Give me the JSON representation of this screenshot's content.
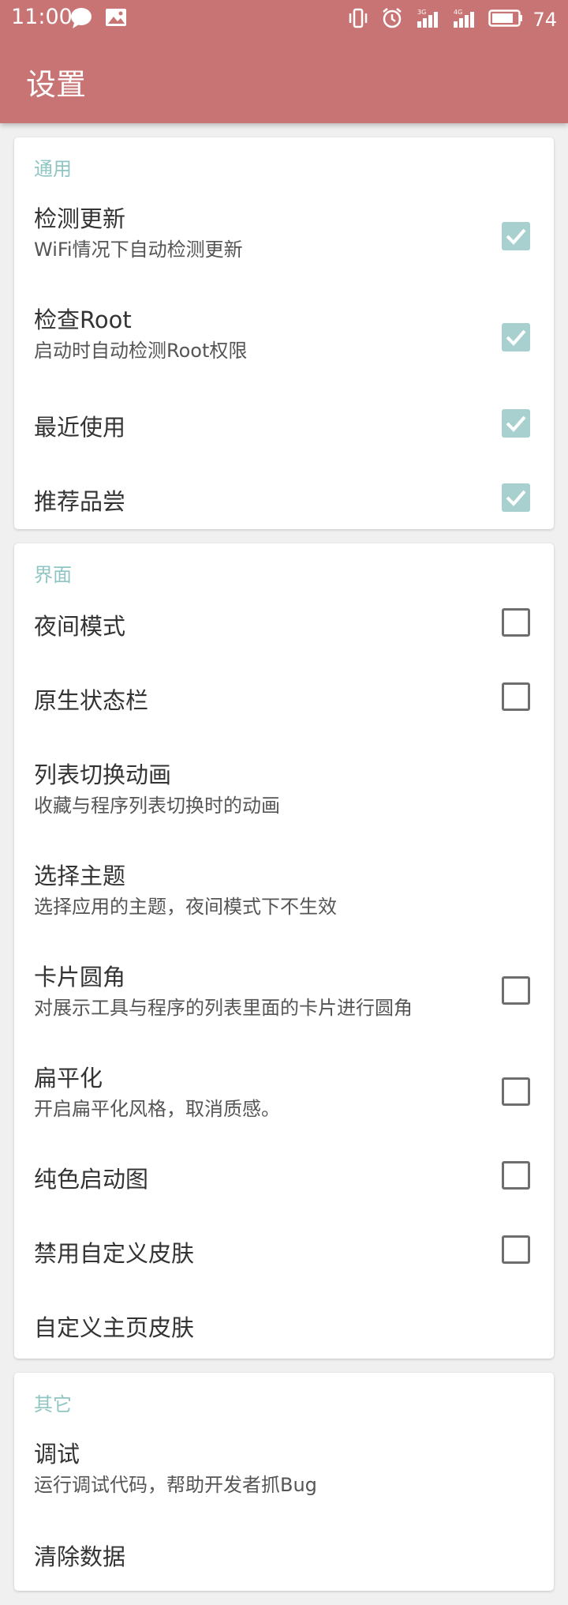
{
  "status_bar": {
    "time": "11:00",
    "battery_level": "74",
    "left_icons": [
      "chat-bubble-icon",
      "image-icon"
    ],
    "right_icons": [
      "vibrate-icon",
      "alarm-icon",
      "signal-3g-icon",
      "signal-4g-icon",
      "battery-icon"
    ]
  },
  "app_bar": {
    "title": "设置"
  },
  "colors": {
    "app_bar": "#c87474",
    "accent": "#8fc6c4",
    "checkbox_checked": "#a8d0cf",
    "background": "#f0f0f0"
  },
  "sections": [
    {
      "header": "通用",
      "items": [
        {
          "title": "检测更新",
          "subtitle": "WiFi情况下自动检测更新",
          "checkbox": "checked"
        },
        {
          "title": "检查Root",
          "subtitle": "启动时自动检测Root权限",
          "checkbox": "checked"
        },
        {
          "title": "最近使用",
          "checkbox": "checked"
        },
        {
          "title": "推荐品尝",
          "checkbox": "checked"
        }
      ]
    },
    {
      "header": "界面",
      "items": [
        {
          "title": "夜间模式",
          "checkbox": "unchecked"
        },
        {
          "title": "原生状态栏",
          "checkbox": "unchecked"
        },
        {
          "title": "列表切换动画",
          "subtitle": "收藏与程序列表切换时的动画"
        },
        {
          "title": "选择主题",
          "subtitle": "选择应用的主题，夜间模式下不生效"
        },
        {
          "title": "卡片圆角",
          "subtitle": "对展示工具与程序的列表里面的卡片进行圆角",
          "checkbox": "unchecked"
        },
        {
          "title": "扁平化",
          "subtitle": "开启扁平化风格，取消质感。",
          "checkbox": "unchecked"
        },
        {
          "title": "纯色启动图",
          "checkbox": "unchecked"
        },
        {
          "title": "禁用自定义皮肤",
          "checkbox": "unchecked"
        },
        {
          "title": "自定义主页皮肤"
        }
      ]
    },
    {
      "header": "其它",
      "items": [
        {
          "title": "调试",
          "subtitle": "运行调试代码，帮助开发者抓Bug"
        },
        {
          "title": "清除数据"
        }
      ]
    }
  ]
}
